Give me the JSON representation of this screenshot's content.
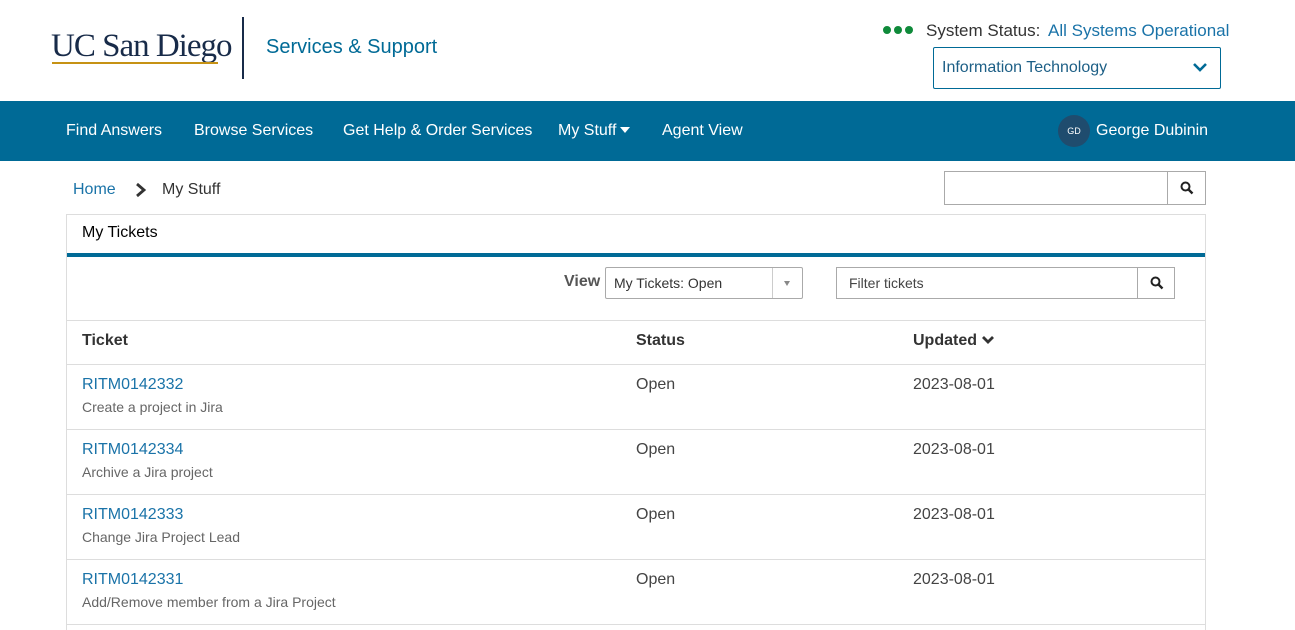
{
  "header": {
    "logo_text": "UC San Diego",
    "site_title": "Services & Support",
    "status_label": "System Status:",
    "status_value": "All Systems Operational",
    "status_color": "#0f8a3a",
    "department_select": "Information Technology"
  },
  "nav": {
    "items": [
      {
        "label": "Find Answers"
      },
      {
        "label": "Browse Services"
      },
      {
        "label": "Get Help & Order Services"
      },
      {
        "label": "My Stuff"
      },
      {
        "label": "Agent View"
      }
    ],
    "user_initials": "GD",
    "user_name": "George Dubinin"
  },
  "breadcrumb": {
    "home": "Home",
    "current": "My Stuff"
  },
  "panel": {
    "title": "My Tickets",
    "view_label": "View",
    "view_selected": "My Tickets: Open",
    "filter_placeholder": "Filter tickets",
    "columns": {
      "ticket": "Ticket",
      "status": "Status",
      "updated": "Updated"
    },
    "rows": [
      {
        "number": "RITM0142332",
        "description": "Create a project in Jira",
        "status": "Open",
        "updated": "2023-08-01"
      },
      {
        "number": "RITM0142334",
        "description": "Archive a Jira project",
        "status": "Open",
        "updated": "2023-08-01"
      },
      {
        "number": "RITM0142333",
        "description": "Change Jira Project Lead",
        "status": "Open",
        "updated": "2023-08-01"
      },
      {
        "number": "RITM0142331",
        "description": "Add/Remove member from a Jira Project",
        "status": "Open",
        "updated": "2023-08-01"
      }
    ]
  },
  "colors": {
    "brand_navy": "#182b49",
    "brand_gold": "#c69214",
    "nav_blue": "#006a96",
    "link_blue": "#1a73a8"
  }
}
